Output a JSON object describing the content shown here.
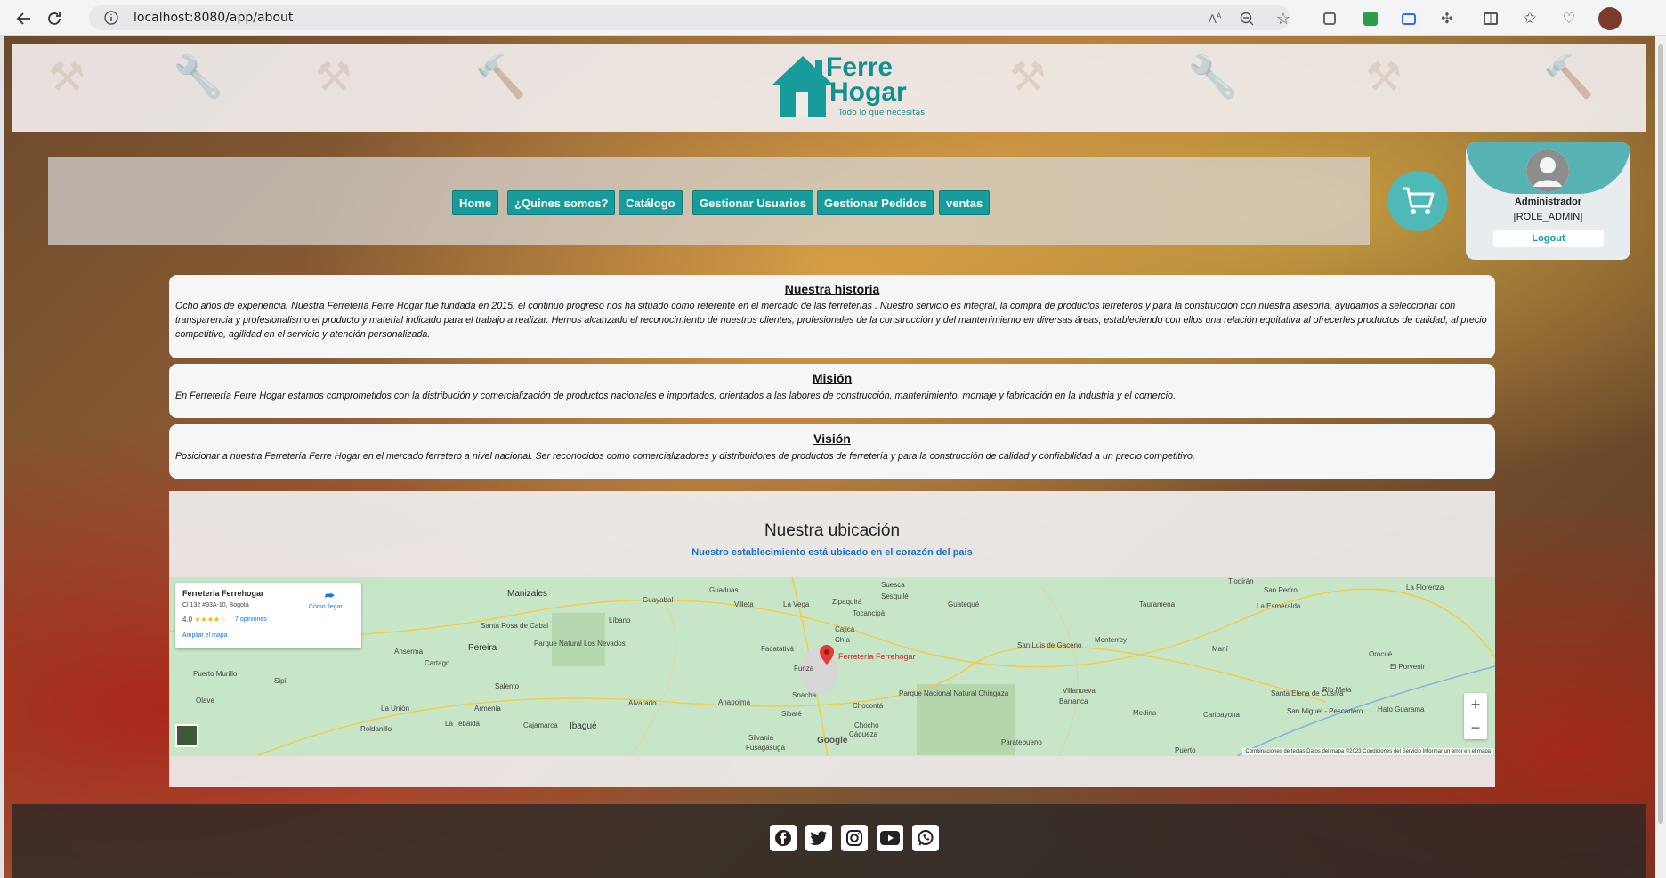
{
  "browser": {
    "url": "localhost:8080/app/about"
  },
  "brand": {
    "line1": "Ferre",
    "line2": "Hogar",
    "tagline": "Todo lo que necesitas",
    "color": "#179b9b"
  },
  "nav": {
    "items": [
      {
        "label": "Home"
      },
      {
        "label": "¿Quines somos?"
      },
      {
        "label": "Catálogo"
      },
      {
        "label": "Gestionar Usuarios"
      },
      {
        "label": "Gestionar Pedidos"
      },
      {
        "label": "ventas"
      }
    ]
  },
  "user": {
    "name": "Administrador",
    "role": "[ROLE_ADMIN]",
    "logout": "Logout"
  },
  "sections": {
    "history": {
      "title": "Nuestra historia",
      "text": "Ocho años de experiencia. Nuestra Ferretería Ferre Hogar fue fundada en 2015, el continuo progreso nos ha situado como referente en el mercado de las ferreterías . Nuestro servicio es integral, la compra de productos ferreteros y para la construcción con nuestra asesoría, ayudamos a seleccionar con transparencia y profesionalismo el producto y material indicado para el trabajo a realizar. Hemos alcanzado el reconocimiento de nuestros clientes, profesionales de la construcción y del mantenimiento en diversas áreas, estableciendo con ellos una relación equitativa al ofrecerles productos de calidad, al precio competitivo, agilidad en el servicio y atención personalizada."
    },
    "mission": {
      "title": "Misión",
      "text": "En Ferretería Ferre Hogar estamos comprometidos con la distribución y comercialización de productos nacionales e importados, orientados a las labores de construcción, mantenimiento, montaje y fabricación en la industria y el comercio."
    },
    "vision": {
      "title": "Visión",
      "text": "Posicionar a nuestra Ferretería Ferre Hogar en el mercado ferretero a nivel nacional. Ser reconocidos como comercializadores y distribuidores de productos de ferretería y para la construcción de calidad y confiabilidad a un precio competitivo."
    }
  },
  "location": {
    "title": "Nuestra ubicación",
    "subtitle": "Nuestro establecimiento está ubicado en el corazón del pais",
    "map": {
      "place_name": "Ferretería Ferrehogar",
      "address": "Cl 132 #93A-10, Bogotá",
      "rating": "4.0",
      "stars": "★★★★☆",
      "reviews": "7 opiniones",
      "expand": "Ampliar el mapa",
      "directions": "Cómo llegar",
      "pin_label": "Ferretería Ferrehogar",
      "zoom_in": "+",
      "zoom_out": "−",
      "google": "Google",
      "footer": "Combinaciones de teclas   Datos del mapa ©2023   Condiciones del Servicio   Informar un error en el mapa",
      "labels": [
        "Manizales",
        "Guaduas",
        "Suesca",
        "Sesquilé",
        "Guayabal",
        "Villeta",
        "La Vega",
        "Zipaquirá",
        "Tocancipá",
        "Guatequé",
        "Tauramena",
        "Tiodirán",
        "San Pedro",
        "La Florenza",
        "La Esmeralda",
        "Líbano",
        "Cajicá",
        "Chía",
        "Santa Rosa de Cabal",
        "Parque Natural Los Nevados",
        "Pereira",
        "Anserma",
        "Cartago",
        "Facatativá",
        "Funza",
        "San Luis de Gaceno",
        "Monterrey",
        "Maní",
        "Orocué",
        "El Porvenir",
        "Puerto Murillo",
        "Salento",
        "Ibagué",
        "Soacha",
        "Sibaté",
        "Anapoima",
        "Chocontá",
        "Parque Nacional Natural Chingaza",
        "Villanueva",
        "Barranca",
        "Santa Elena de Cusiva",
        "San Miguel - Pescadero",
        "Hato Guarama",
        "Río Meta",
        "Olave",
        "La Unión",
        "Armenia",
        "La Tebaida",
        "Cajamarca",
        "Alvarado",
        "Chocho",
        "Medina",
        "Caribayona",
        "Roldanillo",
        "Silvania",
        "Fusagasugá",
        "Cáqueza",
        "Paratebueno",
        "Sipí",
        "Puerto"
      ]
    }
  },
  "footer": {
    "social": [
      "facebook-icon",
      "twitter-icon",
      "instagram-icon",
      "youtube-icon",
      "whatsapp-icon"
    ]
  }
}
